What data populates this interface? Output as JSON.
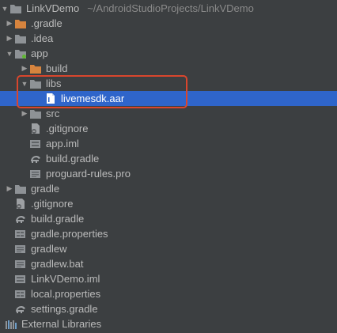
{
  "project": {
    "name": "LinkVDemo",
    "path": "~/AndroidStudioProjects/LinkVDemo"
  },
  "tree": {
    "gradle_dir": ".gradle",
    "idea_dir": ".idea",
    "app": {
      "label": "app",
      "build": "build",
      "libs": "libs",
      "aar_file": "livemesdk.aar",
      "src": "src",
      "gitignore": ".gitignore",
      "iml": "app.iml",
      "build_gradle": "build.gradle",
      "proguard": "proguard-rules.pro"
    },
    "gradle": "gradle",
    "root_gitignore": ".gitignore",
    "root_build_gradle": "build.gradle",
    "gradle_properties": "gradle.properties",
    "gradlew": "gradlew",
    "gradlew_bat": "gradlew.bat",
    "root_iml": "LinkVDemo.iml",
    "local_properties": "local.properties",
    "settings_gradle": "settings.gradle",
    "external_libraries": "External Libraries"
  },
  "colors": {
    "background": "#3c3f41",
    "selection": "#2f65ca",
    "annotation": "#d9462d",
    "folder": "#8e9296",
    "orange_folder": "#d7843e"
  }
}
